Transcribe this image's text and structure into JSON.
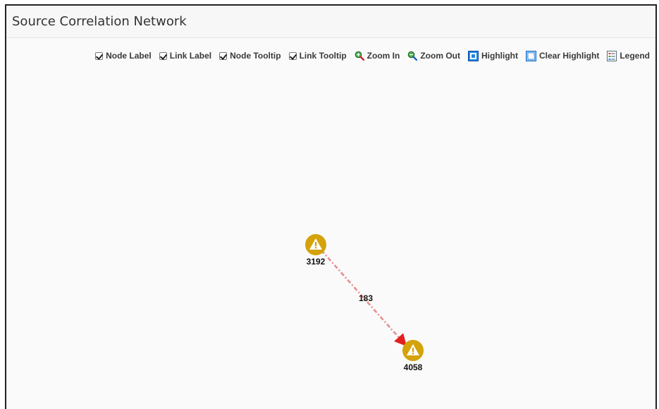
{
  "panel": {
    "title": "Source Correlation Network"
  },
  "toolbar": {
    "node_label": "Node Label",
    "link_label": "Link Label",
    "node_tooltip": "Node Tooltip",
    "link_tooltip": "Link Tooltip",
    "zoom_in": "Zoom In",
    "zoom_out": "Zoom Out",
    "highlight": "Highlight",
    "clear_highlight": "Clear Highlight",
    "legend": "Legend"
  },
  "network": {
    "nodes": [
      {
        "id": "3192",
        "label": "3192",
        "icon": "warning-icon"
      },
      {
        "id": "4058",
        "label": "4058",
        "icon": "warning-icon"
      }
    ],
    "links": [
      {
        "from": "3192",
        "to": "4058",
        "label": "183"
      }
    ]
  },
  "colors": {
    "node_fill": "#d4a20a",
    "link": "#e88a8a",
    "arrow": "#e02020"
  }
}
